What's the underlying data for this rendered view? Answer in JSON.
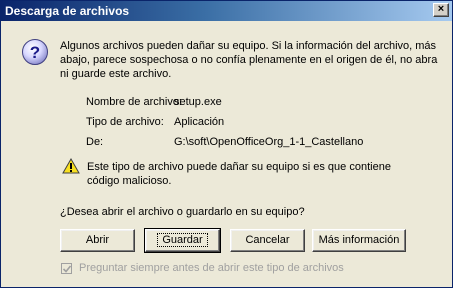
{
  "window": {
    "title": "Descarga de archivos",
    "close_label": "×"
  },
  "dialog": {
    "intro_lines": [
      "Algunos archivos pueden dañar su equipo. Si la información del archivo, más",
      "abajo, parece sospechosa o no confía plenamente en el origen de él, no abra",
      "ni guarde este archivo."
    ],
    "file_info": [
      {
        "label": "Nombre de archivo:",
        "value": "setup.exe"
      },
      {
        "label": "Tipo de archivo:",
        "value": "Aplicación"
      },
      {
        "label": "De:",
        "value": "G:\\soft\\OpenOfficeOrg_1-1_Castellano"
      }
    ],
    "warning_lines": [
      "Este tipo de archivo puede dañar su equipo si es que contiene",
      "código malicioso."
    ],
    "question": "¿Desea abrir el archivo o guardarlo en su equipo?",
    "buttons": {
      "open": "Abrir",
      "save": "Guardar",
      "cancel": "Cancelar",
      "more_info": "Más información"
    },
    "checkbox": {
      "label": "Preguntar siempre antes de abrir este tipo de archivos",
      "checked": true,
      "disabled": true
    }
  },
  "icons": {
    "question": "question-icon",
    "warning": "warning-icon",
    "close": "close-icon",
    "check": "check-icon"
  },
  "colors": {
    "titlebar_start": "#0a246a",
    "titlebar_end": "#a6caf0",
    "dialog_bg": "#ece9d8",
    "disabled_text": "#a0a0a0"
  }
}
